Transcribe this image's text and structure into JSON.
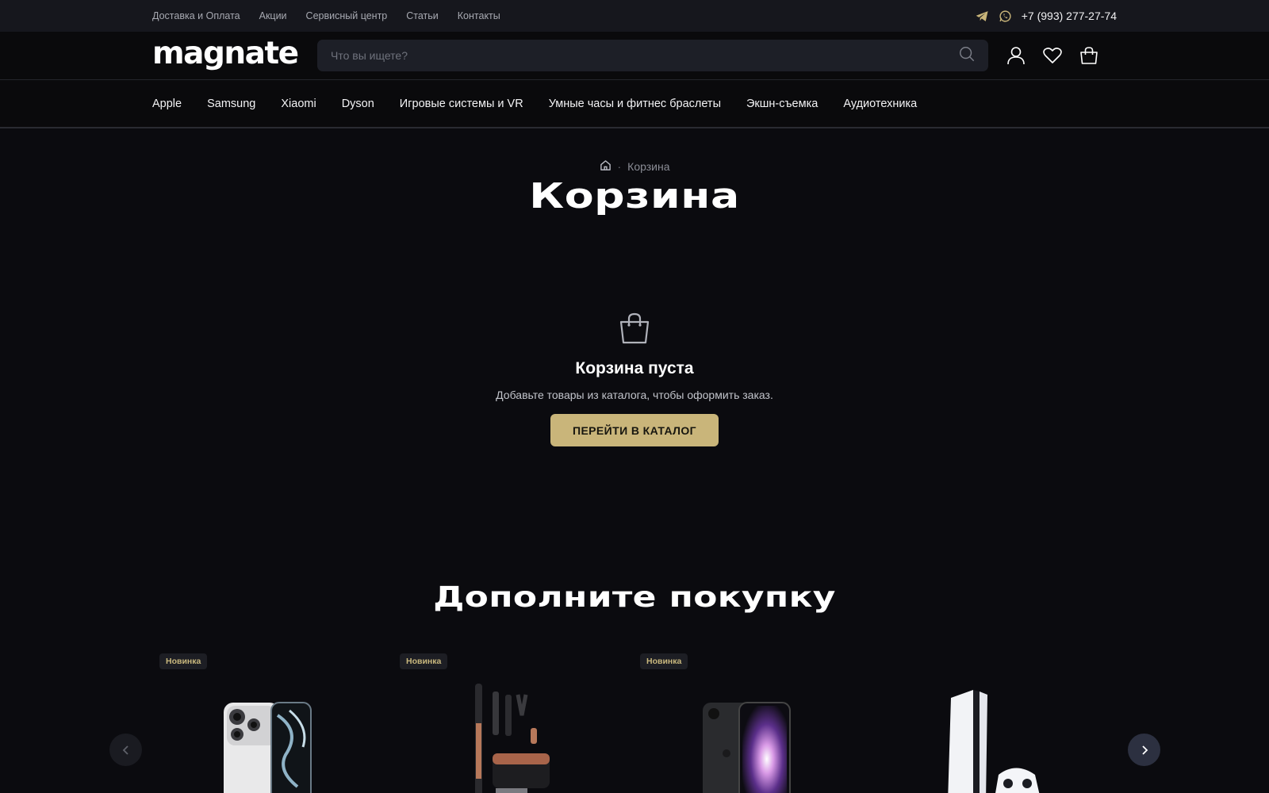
{
  "topbar": {
    "links": [
      "Доставка и Оплата",
      "Акции",
      "Сервисный центр",
      "Статьи",
      "Контакты"
    ],
    "phone": "+7 (993) 277-27-74"
  },
  "header": {
    "logo": "magnate",
    "search_placeholder": "Что вы ищете?",
    "icons": [
      "user-icon",
      "heart-icon",
      "cart-icon"
    ]
  },
  "nav": [
    "Apple",
    "Samsung",
    "Xiaomi",
    "Dyson",
    "Игровые системы и VR",
    "Умные часы и фитнес браслеты",
    "Экшн-съемка",
    "Аудиотехника"
  ],
  "breadcrumb": {
    "current": "Корзина"
  },
  "page_title": "Корзина",
  "empty": {
    "title": "Корзина пуста",
    "description": "Добавьте товары из каталога, чтобы оформить заказ.",
    "button": "ПЕРЕЙТИ В КАТАЛОГ"
  },
  "upsell": {
    "title": "Дополните покупку",
    "products": [
      {
        "badge": "Новинка"
      },
      {
        "badge": "Новинка"
      },
      {
        "badge": "Новинка"
      },
      {
        "badge": ""
      }
    ]
  },
  "colors": {
    "accent": "#c9b57a",
    "background": "#0b0b0f",
    "topbar": "#16171d"
  }
}
